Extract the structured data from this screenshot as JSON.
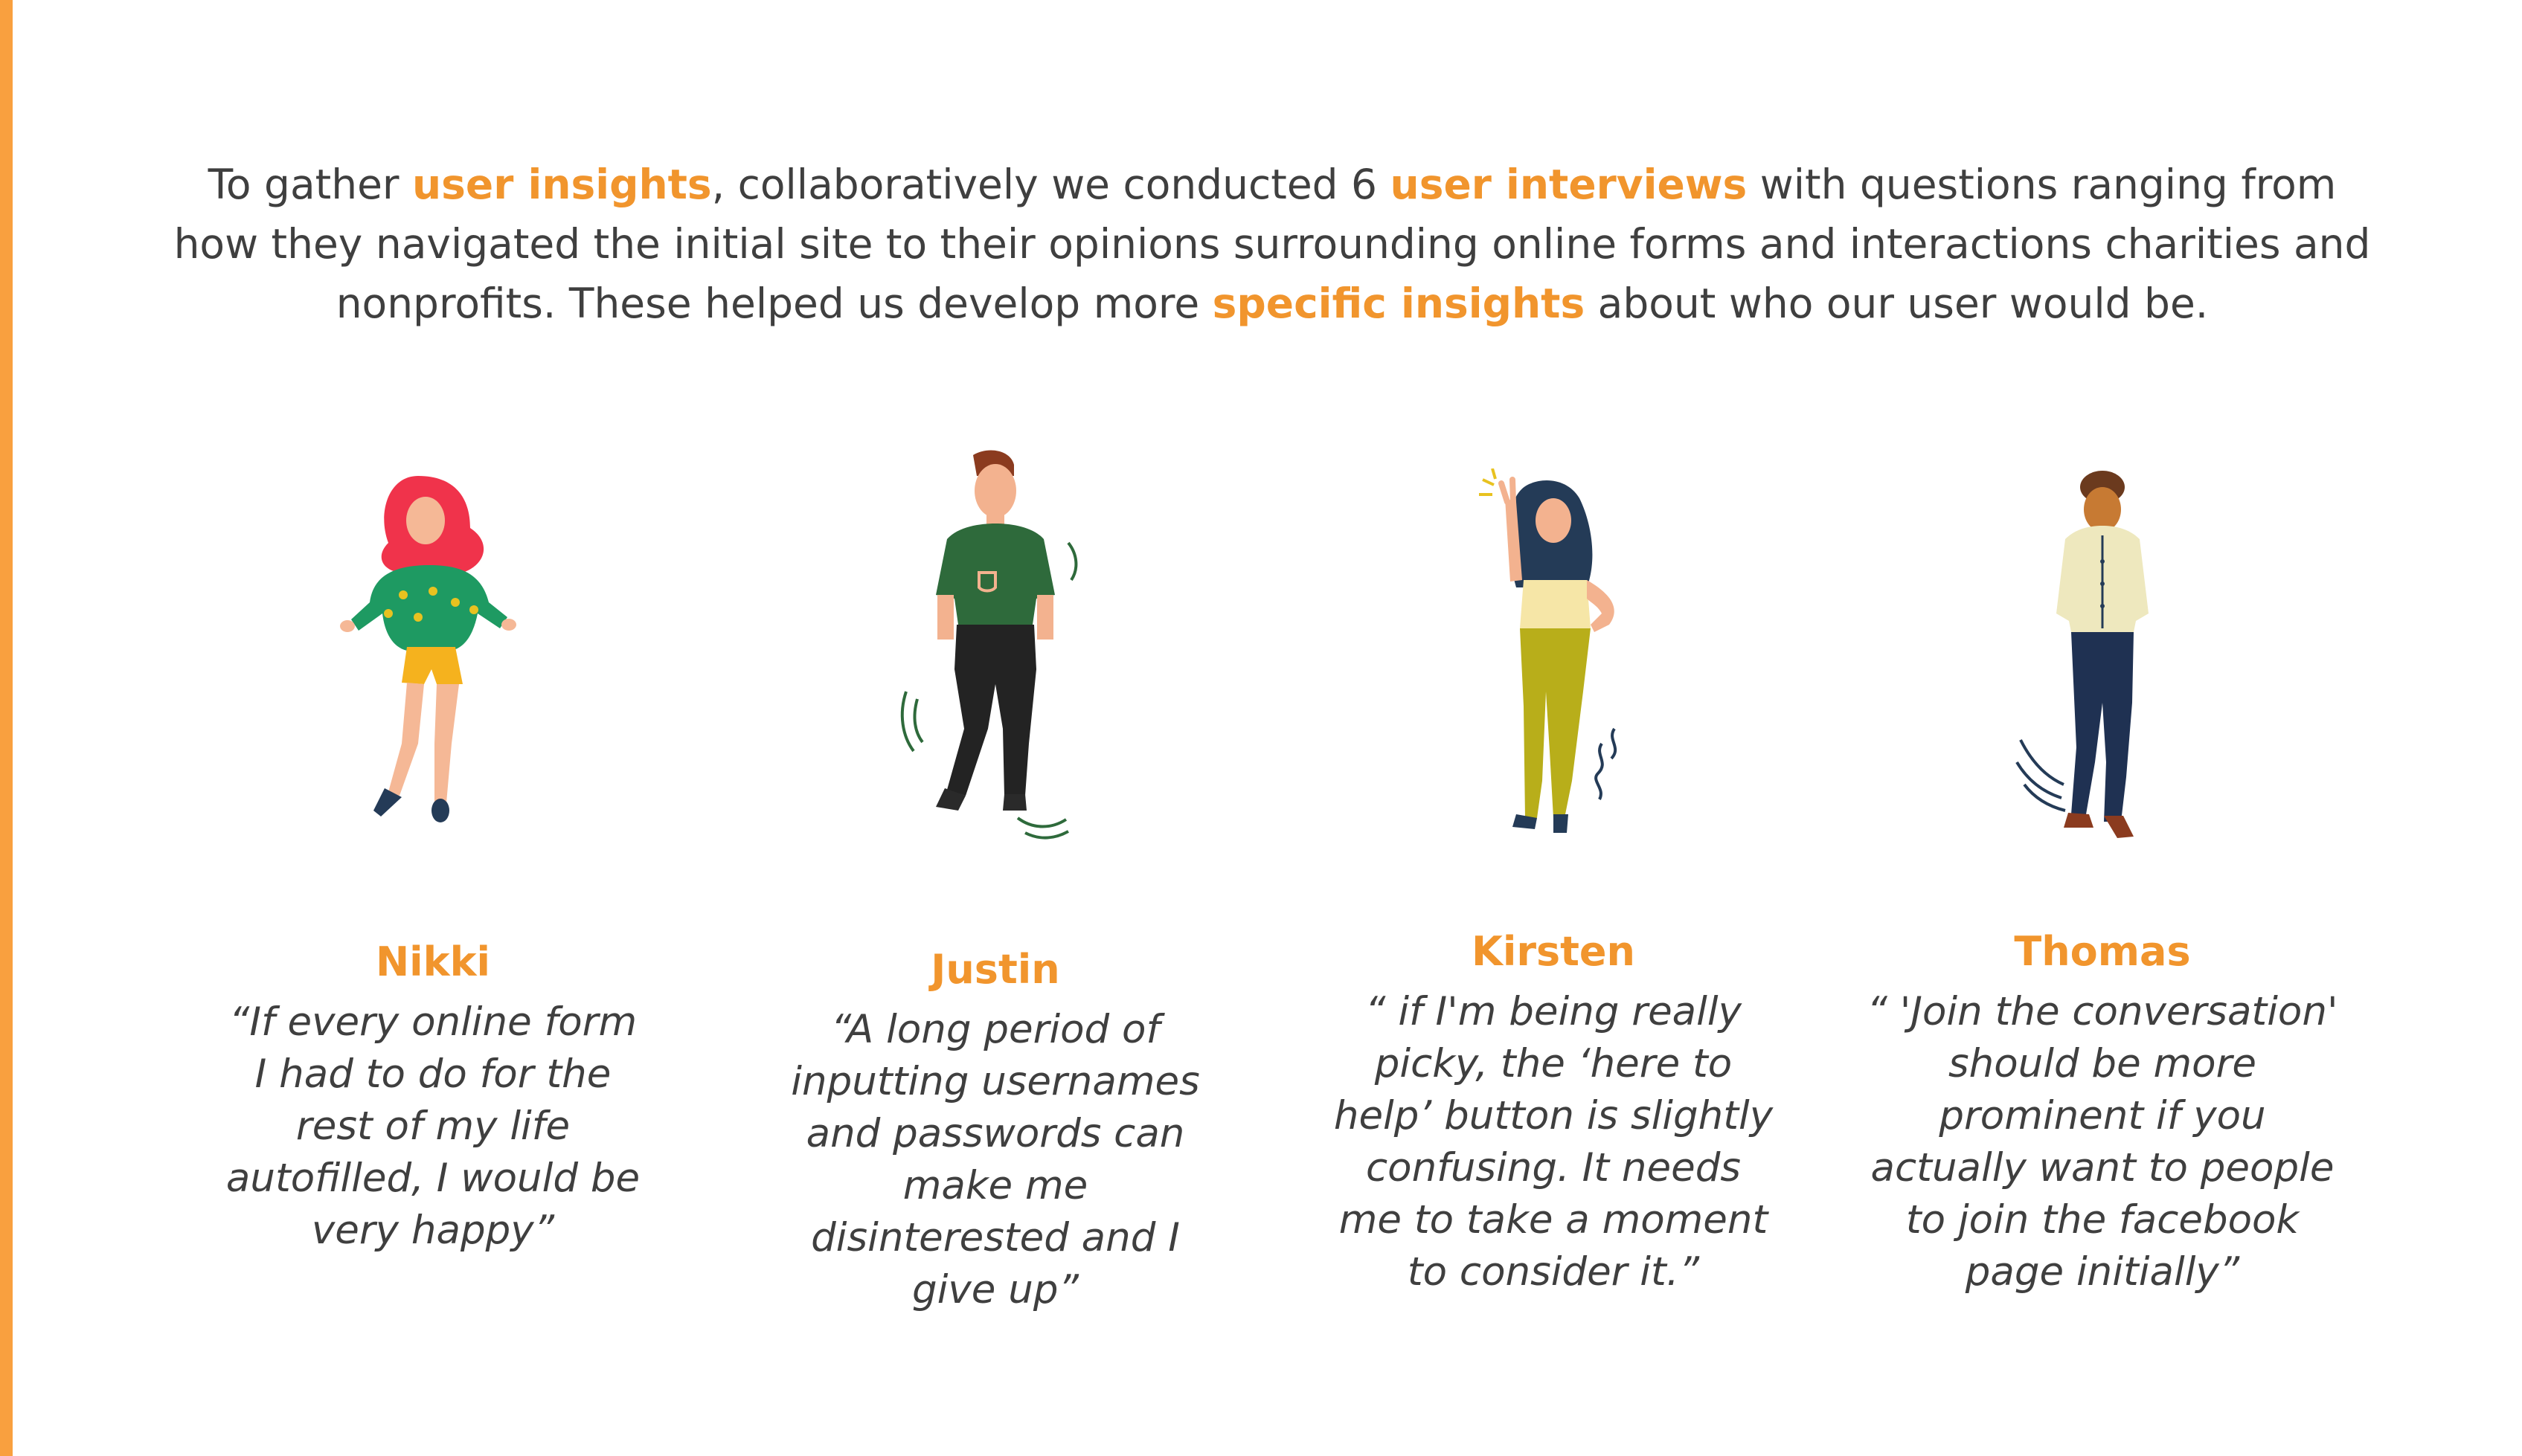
{
  "intro": {
    "t1": "To gather ",
    "h1": "user insights",
    "t2": ", collaboratively we conducted 6 ",
    "h2": "user interviews",
    "t3": " with questions ranging from how they navigated the initial site to their opinions surrounding online forms and interactions charities and nonprofits. These helped us develop more ",
    "h3": "specific insights",
    "t4": " about who our user would be."
  },
  "personas": [
    {
      "name": "Nikki",
      "quote": "“If every online form I had to do for the rest of my life autofilled, I would be very happy”",
      "icon": "woman-red-hair-icon"
    },
    {
      "name": "Justin",
      "quote": "“A long period of inputting usernames and passwords can make me disinterested and I give up”",
      "icon": "man-green-shirt-icon"
    },
    {
      "name": "Kirsten",
      "quote": "“ if I'm being really picky, the ‘here to help’ button is slightly confusing. It needs me to take a moment to consider it.”",
      "icon": "woman-peace-sign-icon"
    },
    {
      "name": "Thomas",
      "quote": "“ 'Join the conversation' should be more prominent if you actually want to people to join the facebook page initially”",
      "icon": "man-beige-shirt-icon"
    }
  ],
  "colors": {
    "accent": "#F1952D",
    "text": "#3f3f3f"
  }
}
